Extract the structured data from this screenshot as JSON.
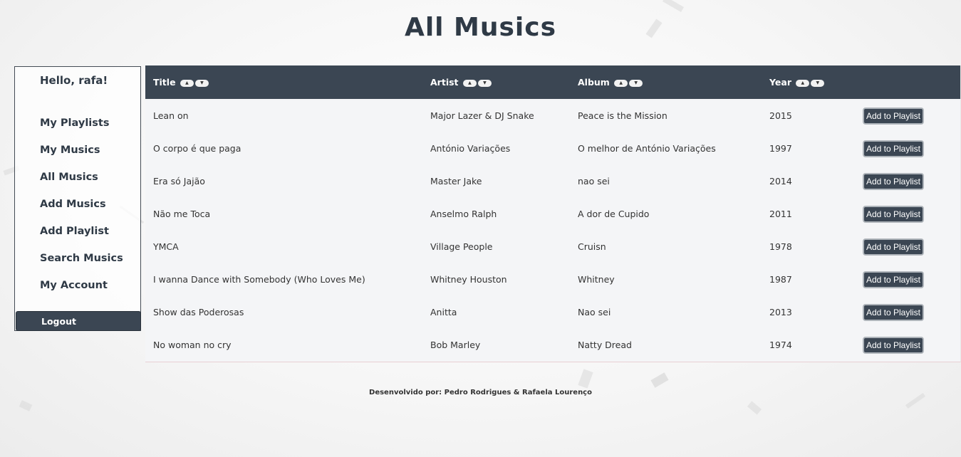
{
  "page": {
    "title": "All Musics"
  },
  "sidebar": {
    "greeting": "Hello, rafa!",
    "items": [
      {
        "label": "My Playlists"
      },
      {
        "label": "My Musics"
      },
      {
        "label": "All Musics"
      },
      {
        "label": "Add Musics"
      },
      {
        "label": "Add Playlist"
      },
      {
        "label": "Search Musics"
      },
      {
        "label": "My Account"
      }
    ],
    "logout_label": "Logout"
  },
  "table": {
    "columns": [
      {
        "label": "Title"
      },
      {
        "label": "Artist"
      },
      {
        "label": "Album"
      },
      {
        "label": "Year"
      }
    ],
    "sort_up_icon": "▲",
    "sort_down_icon": "▼",
    "rows": [
      {
        "title": "Lean on",
        "artist": "Major Lazer & DJ Snake",
        "album": "Peace is the Mission",
        "year": "2015",
        "action": "Add to Playlist"
      },
      {
        "title": "O corpo é que paga",
        "artist": "António Variações",
        "album": "O melhor de António Variações",
        "year": "1997",
        "action": "Add to Playlist"
      },
      {
        "title": "Era só Jajão",
        "artist": "Master Jake",
        "album": "nao sei",
        "year": "2014",
        "action": "Add to Playlist"
      },
      {
        "title": "Não me Toca",
        "artist": "Anselmo Ralph",
        "album": "A dor de Cupido",
        "year": "2011",
        "action": "Add to Playlist"
      },
      {
        "title": "YMCA",
        "artist": "Village People",
        "album": "Cruisn",
        "year": "1978",
        "action": "Add to Playlist"
      },
      {
        "title": "I wanna Dance with Somebody (Who Loves Me)",
        "artist": "Whitney Houston",
        "album": "Whitney",
        "year": "1987",
        "action": "Add to Playlist"
      },
      {
        "title": "Show das Poderosas",
        "artist": "Anitta",
        "album": "Nao sei",
        "year": "2013",
        "action": "Add to Playlist"
      },
      {
        "title": "No woman no cry",
        "artist": "Bob Marley",
        "album": "Natty Dread",
        "year": "1974",
        "action": "Add to Playlist"
      }
    ]
  },
  "footer": {
    "text": "Desenvolvido por: Pedro Rodrigues & Rafaela Lourenço"
  }
}
